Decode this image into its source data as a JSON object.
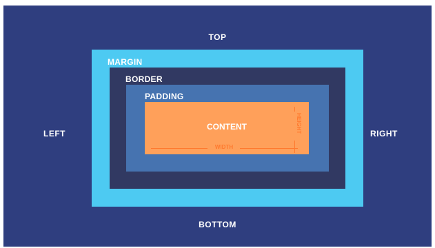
{
  "labels": {
    "top": "TOP",
    "bottom": "BOTTOM",
    "left": "LEFT",
    "right": "RIGHT",
    "margin": "MARGIN",
    "border": "BORDER",
    "padding": "PADDING",
    "content": "CONTENT",
    "width": "WIDTH",
    "height": "HEIGHT"
  },
  "colors": {
    "background": "#2f3e7f",
    "margin": "#4dcaf2",
    "border": "#313962",
    "padding": "#4673b0",
    "content": "#ffa05a",
    "dimension": "#ff7a2f",
    "text": "#ffffff"
  }
}
